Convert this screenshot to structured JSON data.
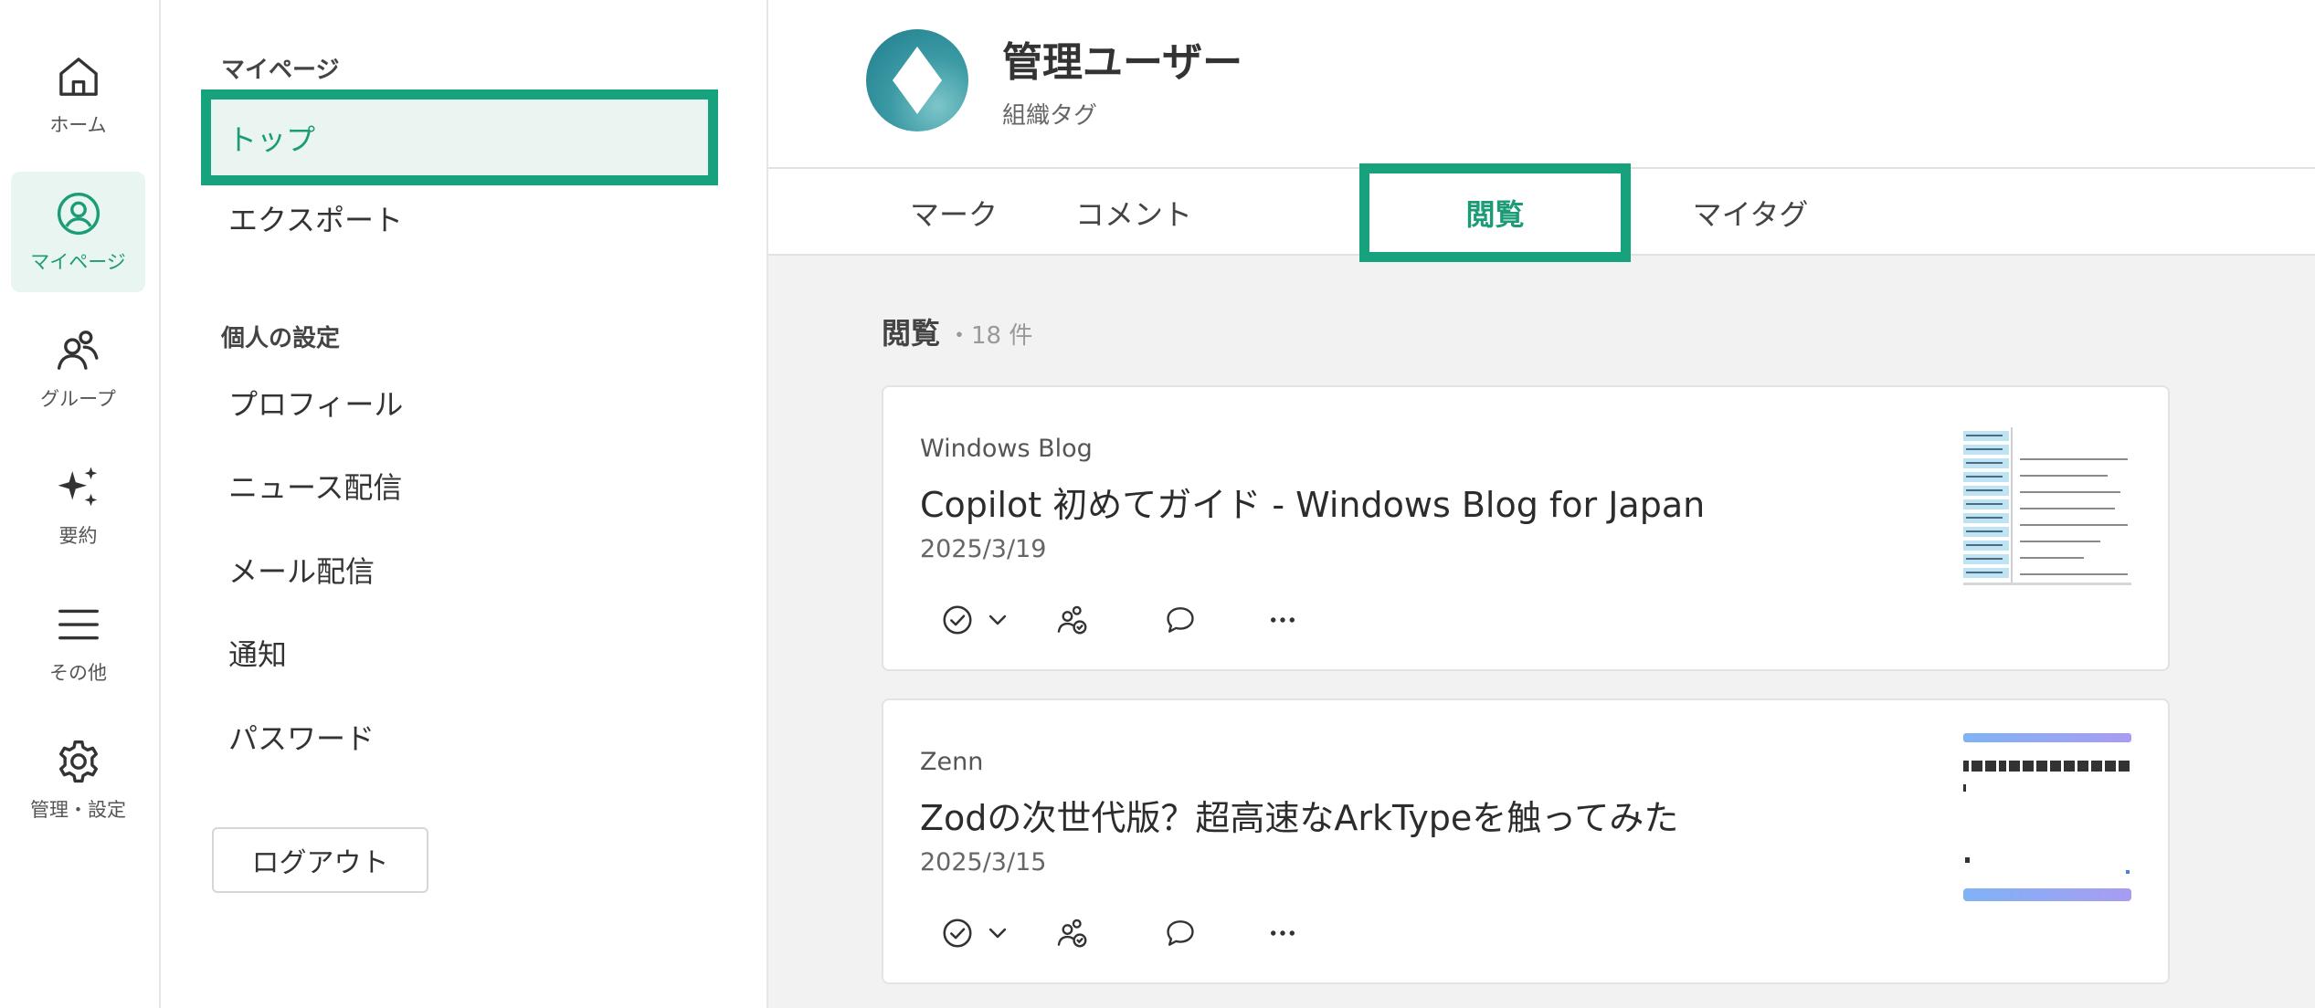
{
  "rail": {
    "items": [
      {
        "label": "ホーム",
        "icon": "home-icon"
      },
      {
        "label": "マイページ",
        "icon": "user-circle-icon"
      },
      {
        "label": "グループ",
        "icon": "group-icon"
      },
      {
        "label": "要約",
        "icon": "sparkle-icon"
      },
      {
        "label": "その他",
        "icon": "menu-icon"
      },
      {
        "label": "管理・設定",
        "icon": "gear-icon"
      }
    ],
    "active_index": 1
  },
  "menu": {
    "mypage_heading": "マイページ",
    "mypage_items": [
      {
        "label": "トップ"
      },
      {
        "label": "エクスポート"
      }
    ],
    "settings_heading": "個人の設定",
    "settings_items": [
      {
        "label": "プロフィール"
      },
      {
        "label": "ニュース配信"
      },
      {
        "label": "メール配信"
      },
      {
        "label": "通知"
      },
      {
        "label": "パスワード"
      }
    ],
    "logout_label": "ログアウト"
  },
  "profile": {
    "name": "管理ユーザー",
    "tag": "組織タグ"
  },
  "tabs": [
    {
      "label": "マーク"
    },
    {
      "label": "コメント"
    },
    {
      "label": "閲覧"
    },
    {
      "label": "マイタグ"
    }
  ],
  "active_tab_index": 2,
  "section": {
    "title": "閲覧",
    "count": "・18 件"
  },
  "cards": [
    {
      "source": "Windows Blog",
      "title": "Copilot 初めてガイド - Windows Blog for Japan",
      "date": "2025/3/19"
    },
    {
      "source": "Zenn",
      "title": "Zodの次世代版？超高速なArkTypeを触ってみた",
      "date": "2025/3/15"
    }
  ],
  "colors": {
    "accent": "#17a27e",
    "accent_text": "#1c9c76",
    "active_bg": "#e9f5f0",
    "main_bg": "#f2f2f2"
  }
}
